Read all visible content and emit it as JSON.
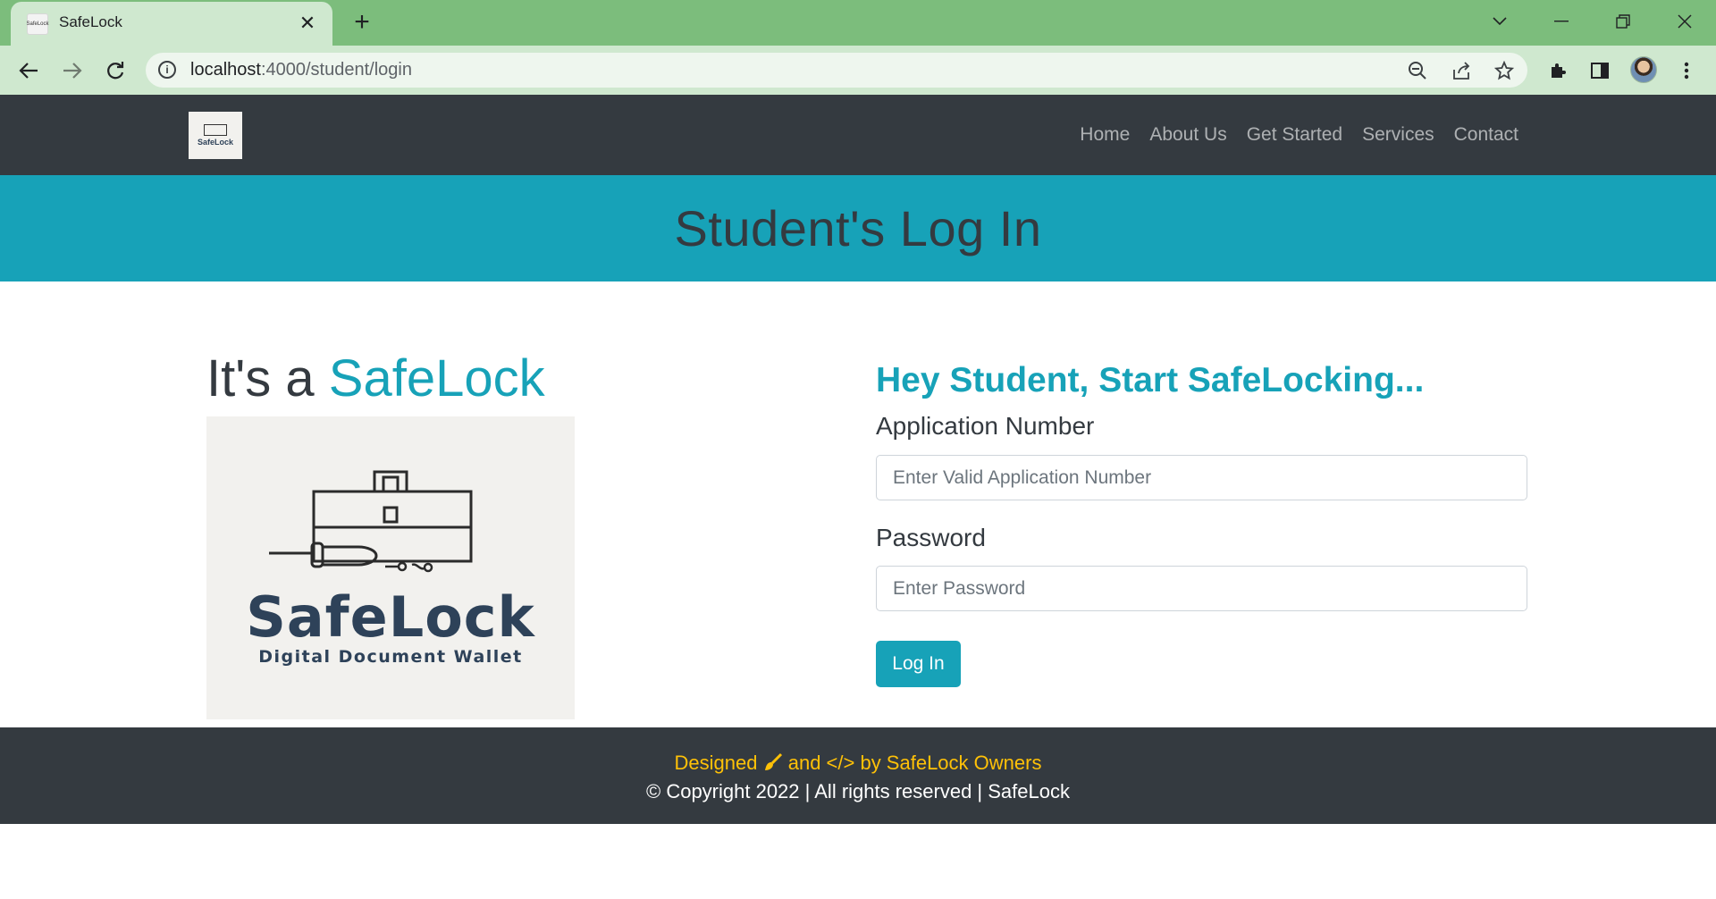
{
  "browser": {
    "tab_title": "SafeLock",
    "favicon_text": "SafeLock",
    "url_host": "localhost",
    "url_path": ":4000/student/login"
  },
  "navbar": {
    "brand": "SafeLock",
    "links": [
      "Home",
      "About Us",
      "Get Started",
      "Services",
      "Contact"
    ]
  },
  "banner": {
    "title": "Student's Log In"
  },
  "hero": {
    "heading_prefix": "It's a ",
    "heading_accent": "SafeLock",
    "logo_name": "SafeLock",
    "logo_tagline": "Digital Document Wallet"
  },
  "form": {
    "heading": "Hey Student, Start SafeLocking...",
    "app_label": "Application Number",
    "app_placeholder": "Enter Valid Application Number",
    "pw_label": "Password",
    "pw_placeholder": "Enter Password",
    "submit": "Log In"
  },
  "footer": {
    "line1_a": "Designed ",
    "line1_b": " and </> by SafeLock Owners",
    "line2": "© Copyright 2022 | All rights reserved | SafeLock"
  },
  "colors": {
    "accent": "#17a2b8",
    "dark": "#343a40",
    "footer_highlight": "#ffc107",
    "chrome_tab": "#7cbd7c"
  },
  "icons": [
    "back-arrow-icon",
    "forward-arrow-icon",
    "reload-icon",
    "info-icon",
    "zoom-out-icon",
    "share-icon",
    "star-icon",
    "extensions-icon",
    "sidepanel-icon",
    "menu-dots-icon",
    "brush-icon"
  ]
}
